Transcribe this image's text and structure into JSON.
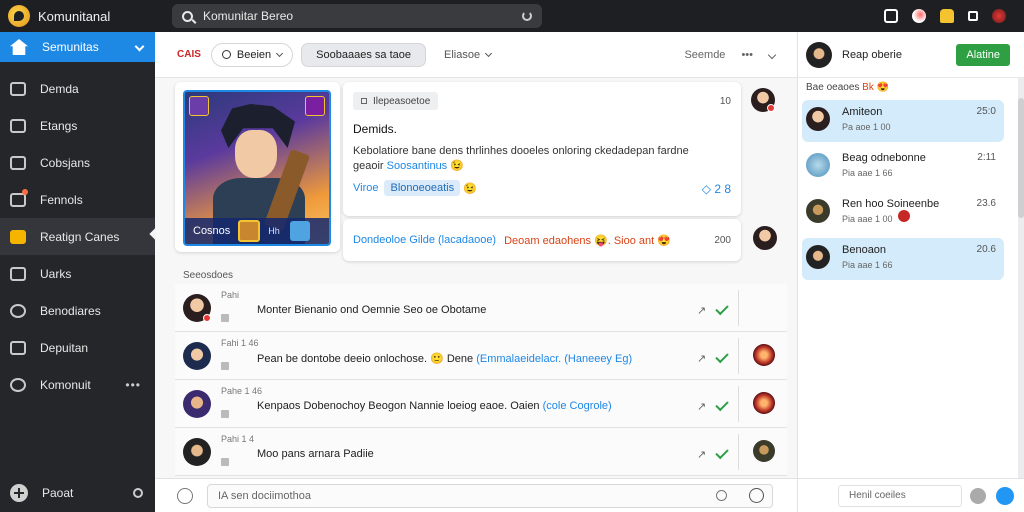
{
  "topbar": {
    "app_name": "Komunitanal",
    "search_text": "Komunitar Bereo"
  },
  "sidebar": {
    "items": [
      {
        "label": "Semunitas"
      },
      {
        "label": "Demda"
      },
      {
        "label": "Etangs"
      },
      {
        "label": "Cobsjans"
      },
      {
        "label": "Fennols"
      },
      {
        "label": "Reatign Canes"
      },
      {
        "label": "Uarks"
      },
      {
        "label": "Benodiares"
      },
      {
        "label": "Depuitan"
      },
      {
        "label": "Komonuit"
      }
    ],
    "bottom_label": "Paoat"
  },
  "main": {
    "header": {
      "logo_text": "CAIS",
      "filter1": "Beeien",
      "filter2": "Soobaaaes sa taoe",
      "filter3": "Eliasoe",
      "right_label": "Seemde"
    },
    "feature": {
      "bar_label": "Cosnos",
      "bar_tag": "Hh"
    },
    "post": {
      "tag": "Ilepeasoetoe",
      "num": "10",
      "title": "Demids.",
      "body": "Kebolatiore bane dens thrlinhes dooeles onloring ckedadepan fardne",
      "body2_plain": "geaoir",
      "body2_blue": "Soosantinus",
      "foot_label": "Viroe",
      "foot_chip": "Blonoeoeatis",
      "stat": "◇ 2 8"
    },
    "reply": {
      "blue_text": "Dondeoloe Gilde (lacadaooe)",
      "red_text": "Deoam edaohens 😝. Sioo ant 😍",
      "num": "200"
    },
    "section_label": "Seeosdoes",
    "feed": [
      {
        "meta": "Pahi",
        "text": "Monter Bienanio ond Oemnie Seo oe Obotame",
        "blue": "",
        "act": "✓"
      },
      {
        "meta": "Fahi 1 46",
        "text": "Pean be dontobe deeio onlochose. 🙂 Dene",
        "blue": "(Emmalaeidelacr. (Haneeey Eg)",
        "act": "✓"
      },
      {
        "meta": "Pahe 1 46",
        "text": "Kenpaos Dobenochoy Beogon Nannie loeiog eaoe. Oaien",
        "blue": "(cole Cogrole)",
        "act": "✓"
      },
      {
        "meta": "Pahi 1 4",
        "text": "Moo pans arnara Padiie",
        "blue": "",
        "act": "✓"
      }
    ],
    "composer_placeholder": "IA sen dociimothoa"
  },
  "right_panel": {
    "name": "Reap oberie",
    "button": "Alatine",
    "sub_plain": "Bae oeaoes ",
    "sub_red": "Bk",
    "conversations": [
      {
        "name": "Amiteon",
        "preview": "Pa aoe 1 00",
        "time": "25:0"
      },
      {
        "name": "Beag odnebonne",
        "preview": "Pia aae 1 66",
        "time": "2:11"
      },
      {
        "name": "Ren hoo Soineenbe",
        "preview": "Pia aae 1 00",
        "time": "23.6"
      },
      {
        "name": "Benoaon",
        "preview": "Pia aae 1 66",
        "time": "20.6"
      }
    ],
    "footer_placeholder": "Henil coeiles"
  },
  "colors": {
    "accent": "#1e88e5",
    "success": "#2ea043",
    "sidebar_bg": "#25262a",
    "topbar_bg": "#1e1f22"
  }
}
